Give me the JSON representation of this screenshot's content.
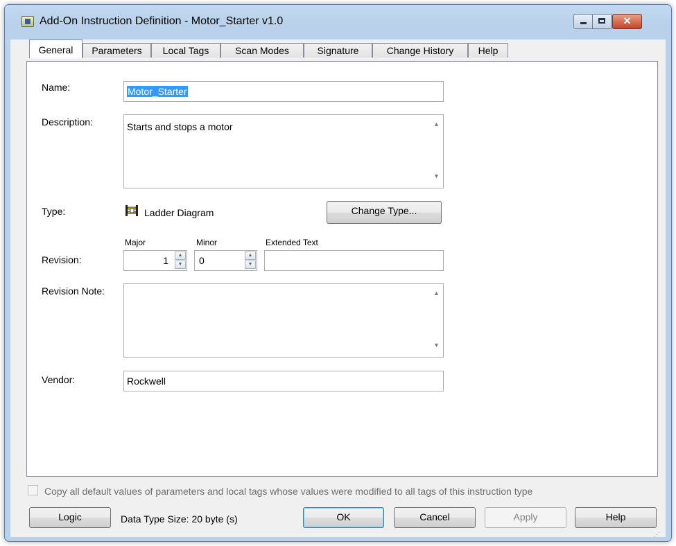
{
  "window": {
    "title": "Add-On Instruction Definition - Motor_Starter v1.0",
    "icon": "aoi-definition-icon",
    "controls": {
      "minimize": "minimize-icon",
      "maximize": "maximize-icon",
      "close": "close-icon"
    }
  },
  "tabs": [
    {
      "label": "General",
      "active": true
    },
    {
      "label": "Parameters"
    },
    {
      "label": "Local Tags"
    },
    {
      "label": "Scan Modes"
    },
    {
      "label": "Signature"
    },
    {
      "label": "Change History"
    },
    {
      "label": "Help"
    }
  ],
  "general": {
    "name_label": "Name:",
    "name_value": "Motor_Starter",
    "description_label": "Description:",
    "description_value": "Starts and stops a motor",
    "type_label": "Type:",
    "type_icon": "ladder-diagram-icon",
    "type_value": "Ladder Diagram",
    "change_type_button": "Change Type...",
    "revision_label": "Revision:",
    "major_label": "Major",
    "minor_label": "Minor",
    "extended_text_label": "Extended Text",
    "major_value": "1",
    "minor_value": "0",
    "extended_text_value": "",
    "revision_note_label": "Revision Note:",
    "revision_note_value": "",
    "vendor_label": "Vendor:",
    "vendor_value": "Rockwell"
  },
  "footer": {
    "copy_defaults_label": "Copy all default values of parameters and local tags whose values were modified to all tags of this instruction type",
    "copy_defaults_checked": false,
    "logic_button": "Logic",
    "data_type_size": "Data Type Size: 20 byte (s)",
    "ok_button": "OK",
    "cancel_button": "Cancel",
    "apply_button": "Apply",
    "help_button": "Help"
  }
}
